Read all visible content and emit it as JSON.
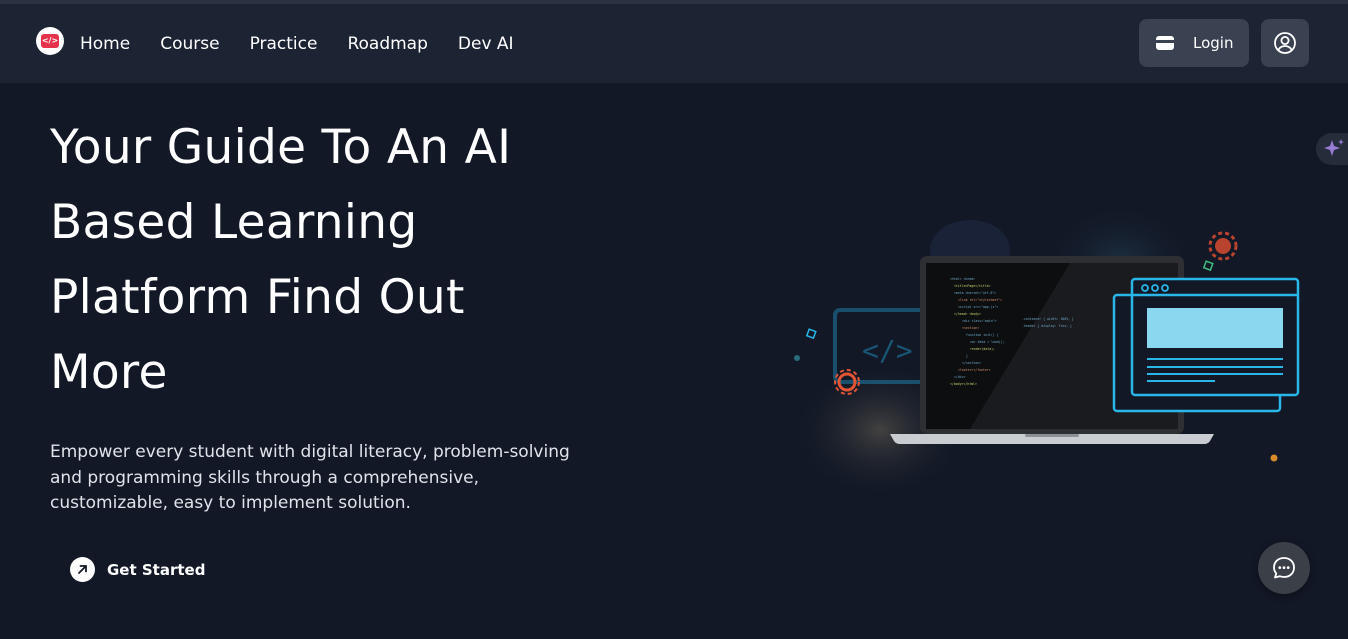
{
  "nav": {
    "links": [
      "Home",
      "Course",
      "Practice",
      "Roadmap",
      "Dev AI"
    ],
    "login_label": "Login"
  },
  "hero": {
    "title_lines": [
      "Your Guide To An AI",
      "Based Learning",
      "Platform Find Out",
      "More"
    ],
    "subtitle": "Empower every student with digital literacy, problem-solving and programming skills through a comprehensive, customizable, easy to implement solution.",
    "cta_label": "Get Started"
  },
  "icons": {
    "logo": "code-screen-logo",
    "login": "wallet-icon",
    "profile": "user-circle-icon",
    "cta": "arrow-up-right-icon",
    "side": "sparkle-icon",
    "chat": "chat-bubble-icon"
  },
  "colors": {
    "background": "#121826",
    "navbar": "#1c2333",
    "button": "#3a4252",
    "accent_red": "#e5334b",
    "accent_cyan": "#29b6e8"
  }
}
